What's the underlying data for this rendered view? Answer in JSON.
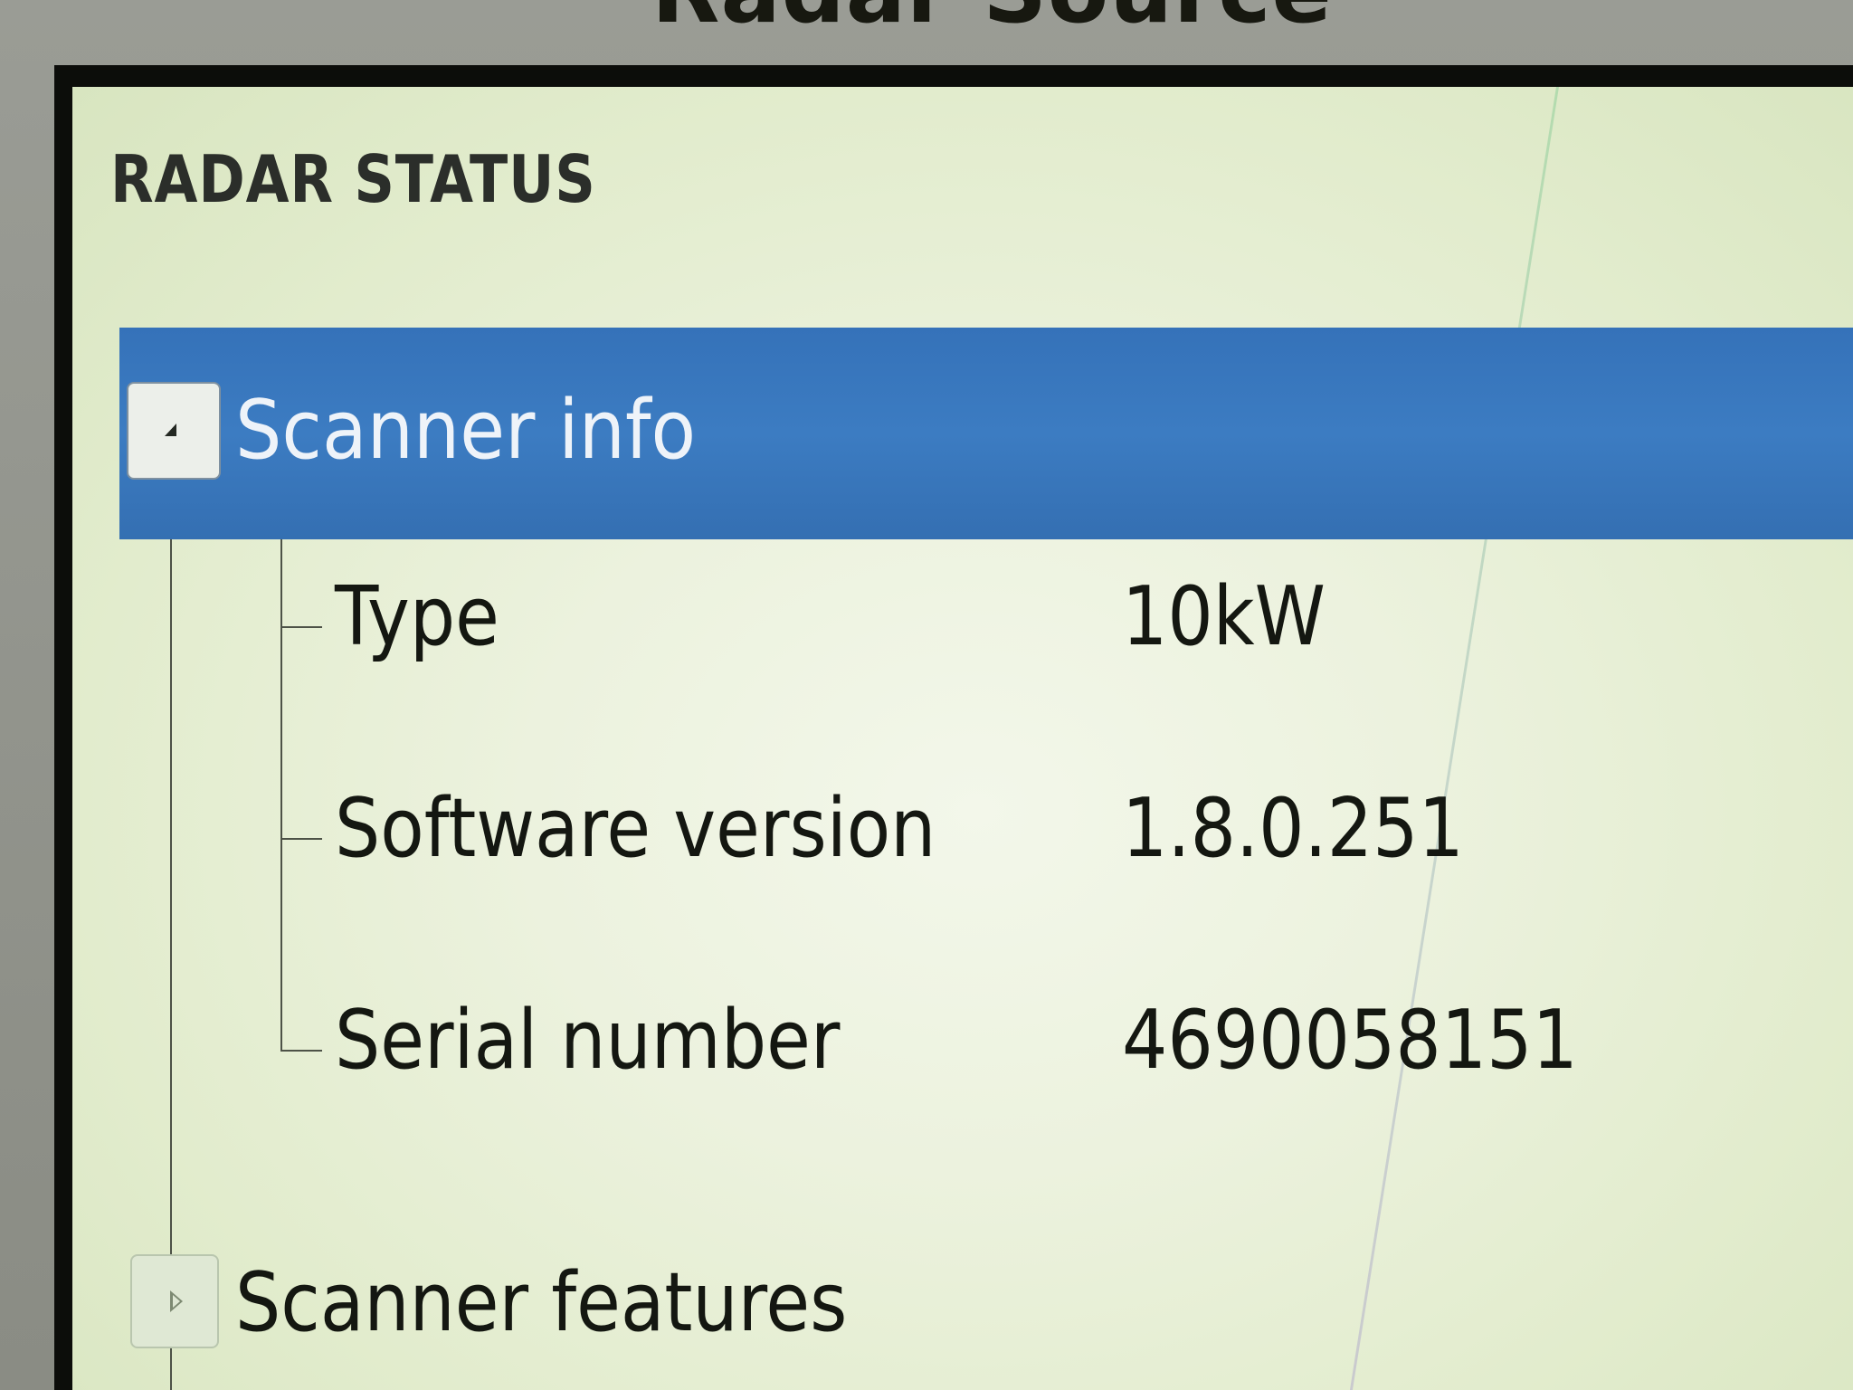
{
  "window": {
    "source_title": "Radar Source"
  },
  "panel": {
    "title": "RADAR STATUS"
  },
  "scanner_info": {
    "label": "Scanner info",
    "expanded": true,
    "toggle_icon": "collapse-triangle-icon",
    "items": [
      {
        "label": "Type",
        "value": "10kW"
      },
      {
        "label": "Software version",
        "value": "1.8.0.251"
      },
      {
        "label": "Serial number",
        "value": "4690058151"
      }
    ]
  },
  "scanner_features": {
    "label": "Scanner features",
    "expanded": false,
    "toggle_icon": "expand-triangle-icon"
  },
  "colors": {
    "selected_row": "#3a78bf",
    "screen_background": "#e6eed6",
    "text": "#141711"
  }
}
